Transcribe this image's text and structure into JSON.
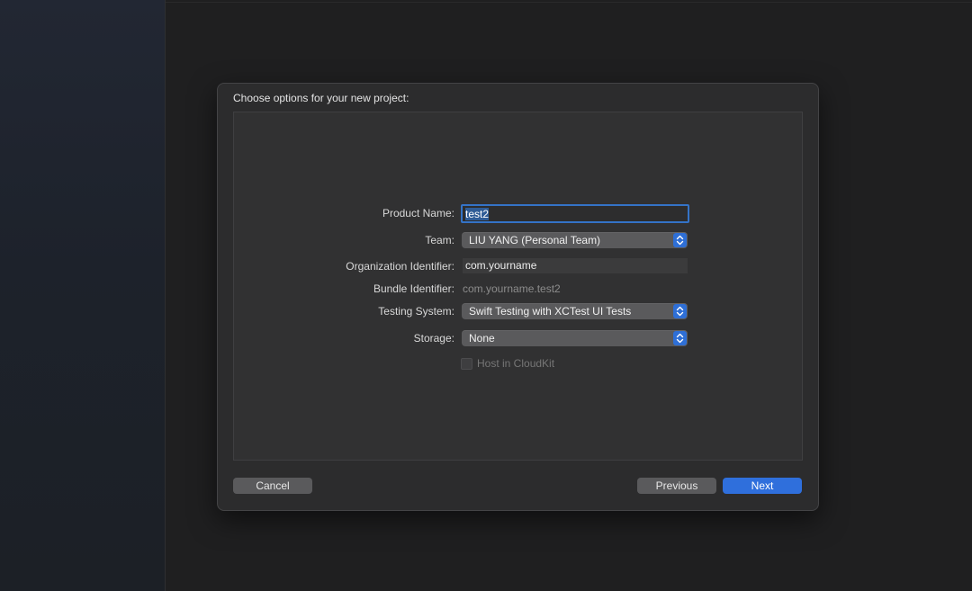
{
  "dialog": {
    "title": "Choose options for your new project:"
  },
  "form": {
    "product_name": {
      "label": "Product Name:",
      "value": "test2"
    },
    "team": {
      "label": "Team:",
      "value": "LIU YANG (Personal Team)"
    },
    "organization_identifier": {
      "label": "Organization Identifier:",
      "value": "com.yourname"
    },
    "bundle_identifier": {
      "label": "Bundle Identifier:",
      "value": "com.yourname.test2"
    },
    "testing_system": {
      "label": "Testing System:",
      "value": "Swift Testing with XCTest UI Tests"
    },
    "storage": {
      "label": "Storage:",
      "value": "None"
    },
    "host_in_cloudkit": {
      "label": "Host in CloudKit",
      "checked": false,
      "enabled": false
    }
  },
  "buttons": {
    "cancel": "Cancel",
    "previous": "Previous",
    "next": "Next"
  },
  "colors": {
    "accent": "#2f6fdc",
    "focus_ring": "#3473c7",
    "sheet_bg": "#2c2c2d"
  },
  "icons": {
    "popup_arrows": "up-down-chevron-icon"
  }
}
